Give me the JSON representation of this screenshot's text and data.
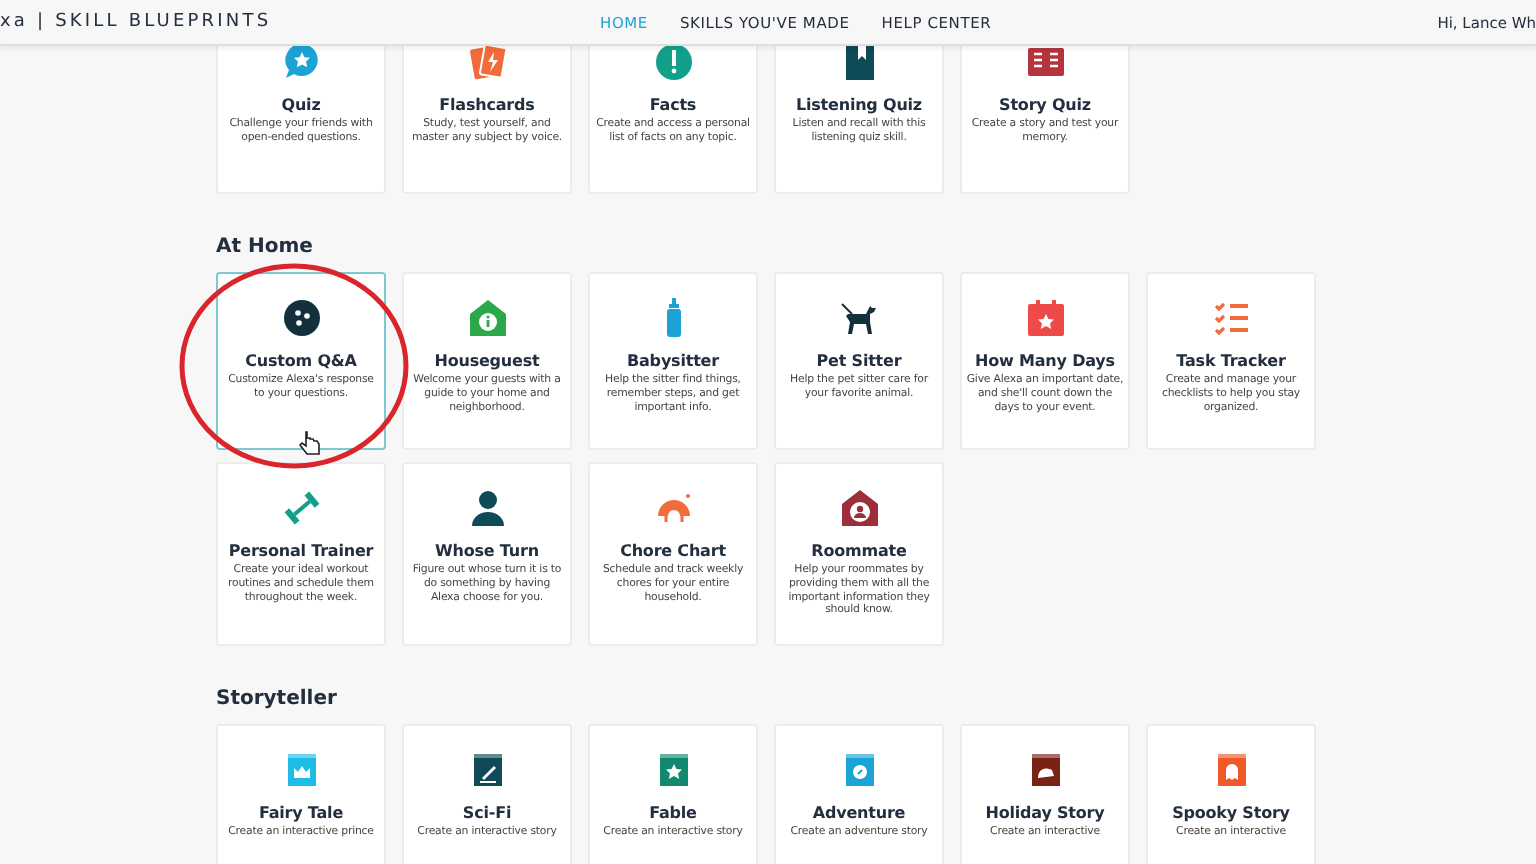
{
  "header": {
    "brand": "xa | SKILL BLUEPRINTS",
    "nav": [
      {
        "label": "HOME",
        "selected": true
      },
      {
        "label": "SKILLS YOU'VE MADE",
        "selected": false
      },
      {
        "label": "HELP CENTER",
        "selected": false
      }
    ],
    "greeting": "Hi, Lance Wh"
  },
  "sections": [
    {
      "cards": [
        {
          "title": "Quiz",
          "description": "Challenge your friends with open-ended questions.",
          "hovered": false
        },
        {
          "title": "Flashcards",
          "description": "Study, test yourself, and master any subject by voice.",
          "hovered": false
        },
        {
          "title": "Facts",
          "description": "Create and access a personal list of facts on any topic.",
          "hovered": false
        },
        {
          "title": "Listening Quiz",
          "description": "Listen and recall with this listening quiz skill.",
          "hovered": false
        },
        {
          "title": "Story Quiz",
          "description": "Create a story and test your memory.",
          "hovered": false
        }
      ]
    },
    {
      "heading": "At Home",
      "cards": [
        {
          "title": "Custom Q&A",
          "description": "Customize Alexa's response to your questions.",
          "hovered": true
        },
        {
          "title": "Houseguest",
          "description": "Welcome your guests with a guide to your home and neighborhood.",
          "hovered": false
        },
        {
          "title": "Babysitter",
          "description": "Help the sitter find things, remember steps, and get important info.",
          "hovered": false
        },
        {
          "title": "Pet Sitter",
          "description": "Help the pet sitter care for your favorite animal.",
          "hovered": false
        },
        {
          "title": "How Many Days",
          "description": "Give Alexa an important date, and she'll count down the days to your event.",
          "hovered": false
        },
        {
          "title": "Task Tracker",
          "description": "Create and manage your checklists to help you stay organized.",
          "hovered": false
        },
        {
          "title": "Personal Trainer",
          "description": "Create your ideal workout routines and schedule them throughout the week.",
          "hovered": false
        },
        {
          "title": "Whose Turn",
          "description": "Figure out whose turn it is to do something by having Alexa choose for you.",
          "hovered": false
        },
        {
          "title": "Chore Chart",
          "description": "Schedule and track weekly chores for your entire household.",
          "hovered": false
        },
        {
          "title": "Roommate",
          "description": "Help your roommates by providing them with all the important information they should know.",
          "hovered": false
        }
      ]
    },
    {
      "heading": "Storyteller",
      "cards": [
        {
          "title": "Fairy Tale",
          "description": "Create an interactive prince",
          "hovered": false
        },
        {
          "title": "Sci-Fi",
          "description": "Create an interactive story",
          "hovered": false
        },
        {
          "title": "Fable",
          "description": "Create an interactive story",
          "hovered": false
        },
        {
          "title": "Adventure",
          "description": "Create an adventure story",
          "hovered": false
        },
        {
          "title": "Holiday Story",
          "description": "Create an interactive",
          "hovered": false
        },
        {
          "title": "Spooky Story",
          "description": "Create an interactive",
          "hovered": false
        }
      ]
    }
  ]
}
